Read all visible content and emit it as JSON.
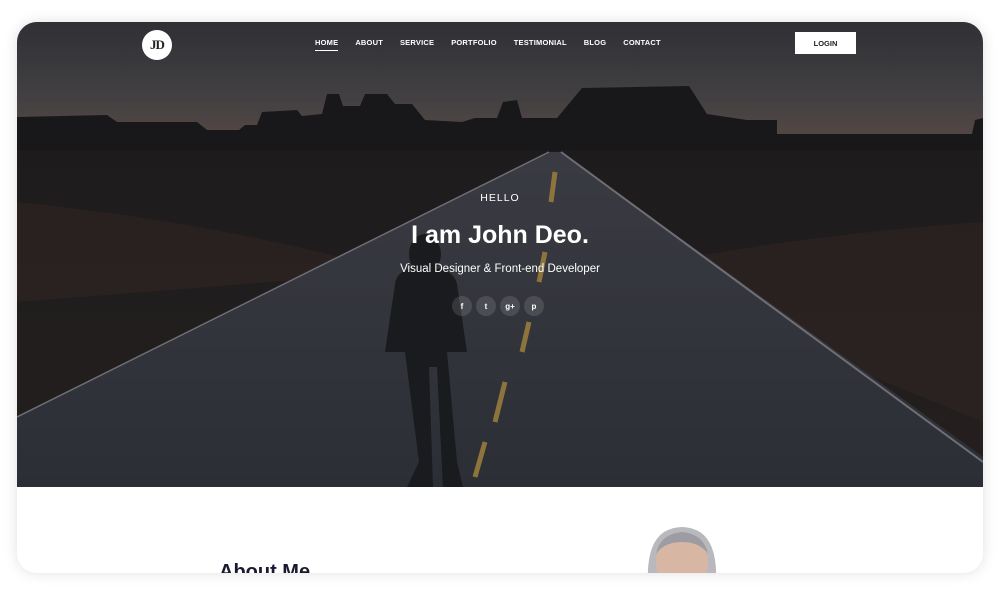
{
  "brand": {
    "logo_text": "JD"
  },
  "nav": {
    "items": [
      "HOME",
      "ABOUT",
      "SERVICE",
      "PORTFOLIO",
      "TESTIMONIAL",
      "BLOG",
      "CONTACT"
    ],
    "active": "HOME",
    "login_label": "LOGIN"
  },
  "hero": {
    "greeting": "HELLO",
    "headline": "I am John Deo.",
    "subtitle": "Visual Designer & Front-end Developer",
    "socials": [
      {
        "icon": "facebook-icon",
        "glyph": "f"
      },
      {
        "icon": "twitter-icon",
        "glyph": "t"
      },
      {
        "icon": "google-plus-icon",
        "glyph": "g+"
      },
      {
        "icon": "pinterest-icon",
        "glyph": "p"
      }
    ]
  },
  "about": {
    "heading": "About Me"
  },
  "colors": {
    "accent_text": "#1a1a2e",
    "hero_overlay": "#1c1e22"
  }
}
